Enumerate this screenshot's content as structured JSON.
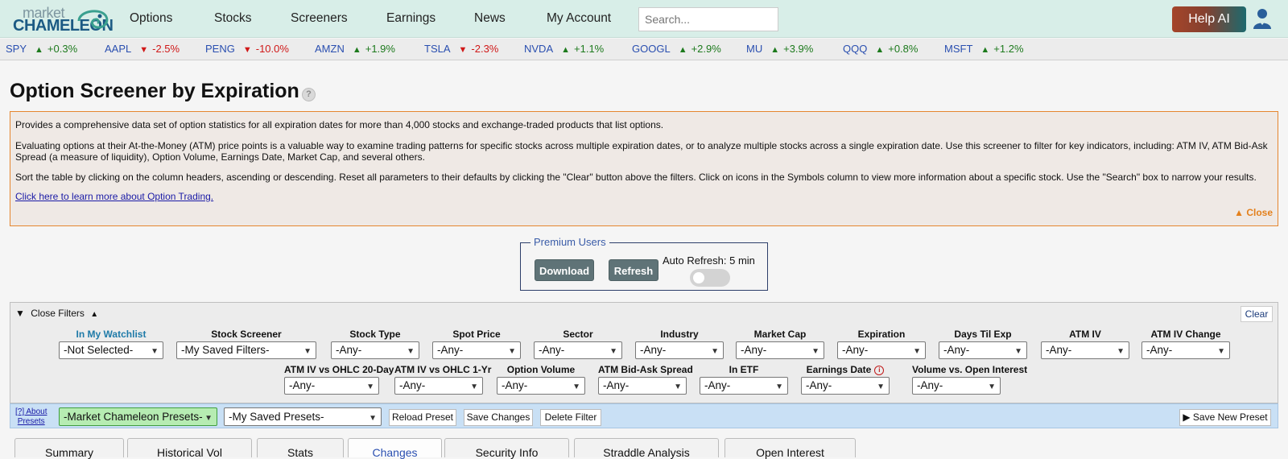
{
  "header": {
    "logo_top": "market",
    "logo_bottom": "CHAMELEON",
    "nav": [
      "Options",
      "Stocks",
      "Screeners",
      "Earnings",
      "News",
      "My Account"
    ],
    "search_placeholder": "Search...",
    "help_ai": "Help AI"
  },
  "ticker": [
    {
      "symbol": "SPY",
      "dir": "up",
      "change": "+0.3%"
    },
    {
      "symbol": "AAPL",
      "dir": "down",
      "change": "-2.5%"
    },
    {
      "symbol": "PENG",
      "dir": "down",
      "change": "-10.0%"
    },
    {
      "symbol": "AMZN",
      "dir": "up",
      "change": "+1.9%"
    },
    {
      "symbol": "TSLA",
      "dir": "down",
      "change": "-2.3%"
    },
    {
      "symbol": "NVDA",
      "dir": "up",
      "change": "+1.1%"
    },
    {
      "symbol": "GOOGL",
      "dir": "up",
      "change": "+2.9%"
    },
    {
      "symbol": "MU",
      "dir": "up",
      "change": "+3.9%"
    },
    {
      "symbol": "QQQ",
      "dir": "up",
      "change": "+0.8%"
    },
    {
      "symbol": "MSFT",
      "dir": "up",
      "change": "+1.2%"
    }
  ],
  "page": {
    "title": "Option Screener by Expiration",
    "help_icon": "?"
  },
  "info": {
    "p1": "Provides a comprehensive data set of option statistics for all expiration dates for more than 4,000 stocks and exchange-traded products that list options.",
    "p2": "Evaluating options at their At-the-Money (ATM) price points is a valuable way to examine trading patterns for specific stocks across multiple expiration dates, or to analyze multiple stocks across a single expiration date. Use this screener to filter for key indicators, including: ATM IV, ATM Bid-Ask Spread (a measure of liquidity), Option Volume, Earnings Date, Market Cap, and several others.",
    "p3": "Sort the table by clicking on the column headers, ascending or descending. Reset all parameters to their defaults by clicking the \"Clear\" button above the filters. Click on icons in the Symbols column to view more information about a specific stock. Use the \"Search\" box to narrow your results.",
    "learn_link": "Click here to learn more about Option Trading.",
    "close": "▲ Close"
  },
  "premium": {
    "legend": "Premium Users",
    "download": "Download",
    "refresh": "Refresh",
    "auto_refresh": "Auto Refresh: 5 min",
    "auto_refresh_on": false
  },
  "filters": {
    "toggle_label": "Close Filters",
    "clear": "Clear",
    "row1": [
      {
        "label": "In My Watchlist",
        "value": "-Not Selected-"
      },
      {
        "label": "Stock Screener",
        "value": "-My Saved Filters-"
      },
      {
        "label": "Stock Type",
        "value": "-Any-"
      },
      {
        "label": "Spot Price",
        "value": "-Any-"
      },
      {
        "label": "Sector",
        "value": "-Any-"
      },
      {
        "label": "Industry",
        "value": "-Any-"
      },
      {
        "label": "Market Cap",
        "value": "-Any-"
      },
      {
        "label": "Expiration",
        "value": "-Any-"
      },
      {
        "label": "Days Til Exp",
        "value": "-Any-"
      },
      {
        "label": "ATM IV",
        "value": "-Any-"
      },
      {
        "label": "ATM IV Change",
        "value": "-Any-"
      }
    ],
    "row2": [
      {
        "label": "ATM IV vs OHLC 20-Day",
        "value": "-Any-"
      },
      {
        "label": "ATM IV vs OHLC 1-Yr",
        "value": "-Any-"
      },
      {
        "label": "Option Volume",
        "value": "-Any-"
      },
      {
        "label": "ATM Bid-Ask Spread",
        "value": "-Any-"
      },
      {
        "label": "In ETF",
        "value": "-Any-"
      },
      {
        "label": "Earnings Date",
        "value": "-Any-"
      },
      {
        "label": "Volume vs. Open Interest",
        "value": "-Any-"
      }
    ]
  },
  "presets": {
    "about_line1": "[?] About",
    "about_line2": "Presets",
    "mc_presets": "-Market Chameleon Presets-",
    "my_presets": "-My Saved Presets-",
    "reload": "Reload Preset",
    "save_changes": "Save Changes",
    "delete": "Delete Filter",
    "save_new": "▶ Save New Preset"
  },
  "tabs": [
    "Summary",
    "Historical Vol",
    "Stats",
    "Changes",
    "Security Info",
    "Straddle Analysis",
    "Open Interest"
  ],
  "colors": {
    "header_bg": "#d8eee8",
    "up": "#1d7a1d",
    "down": "#d01818",
    "accent_orange": "#e5862f",
    "link_blue": "#2a4fb0"
  }
}
